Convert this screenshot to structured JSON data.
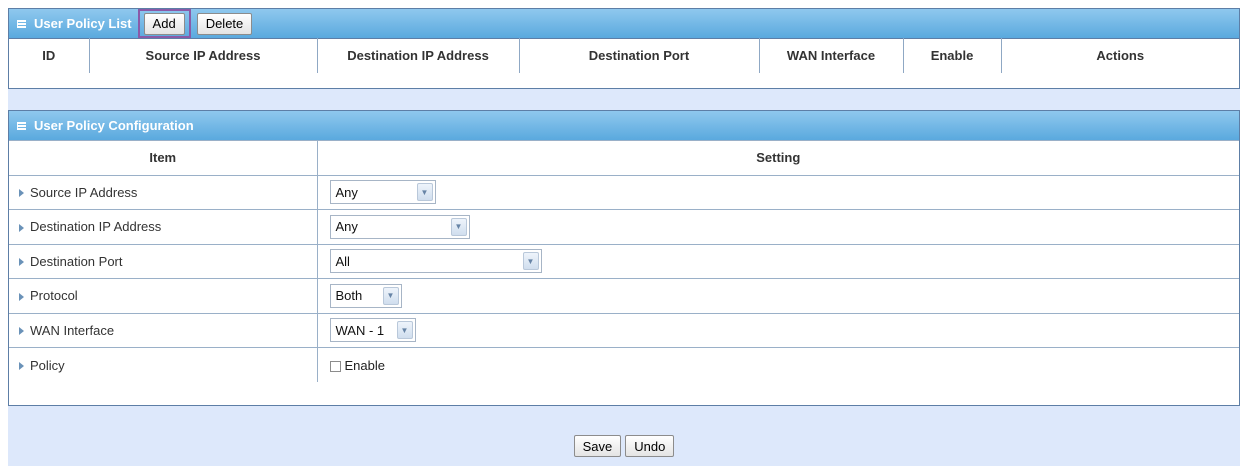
{
  "policy_list": {
    "title": "User Policy List",
    "add_label": "Add",
    "delete_label": "Delete",
    "columns": [
      "ID",
      "Source IP Address",
      "Destination IP Address",
      "Destination Port",
      "WAN Interface",
      "Enable",
      "Actions"
    ]
  },
  "policy_config": {
    "title": "User Policy Configuration",
    "header_item": "Item",
    "header_setting": "Setting",
    "rows": [
      {
        "label": "Source IP Address",
        "value": "Any"
      },
      {
        "label": "Destination IP Address",
        "value": "Any"
      },
      {
        "label": "Destination Port",
        "value": "All"
      },
      {
        "label": "Protocol",
        "value": "Both"
      },
      {
        "label": "WAN Interface",
        "value": "WAN - 1"
      },
      {
        "label": "Policy",
        "checkbox_label": "Enable",
        "checked": false
      }
    ]
  },
  "footer": {
    "save_label": "Save",
    "undo_label": "Undo"
  },
  "icons": {
    "panel_header": "list-icon",
    "row_bullet": "triangle-right-icon",
    "dropdown": "chevron-down-icon"
  },
  "colors": {
    "header_top": "#8fc8ee",
    "header_bottom": "#5aa9de",
    "band": "#dde8fb",
    "border": "#5d7ea6",
    "add_highlight": "#8a5aa8"
  }
}
